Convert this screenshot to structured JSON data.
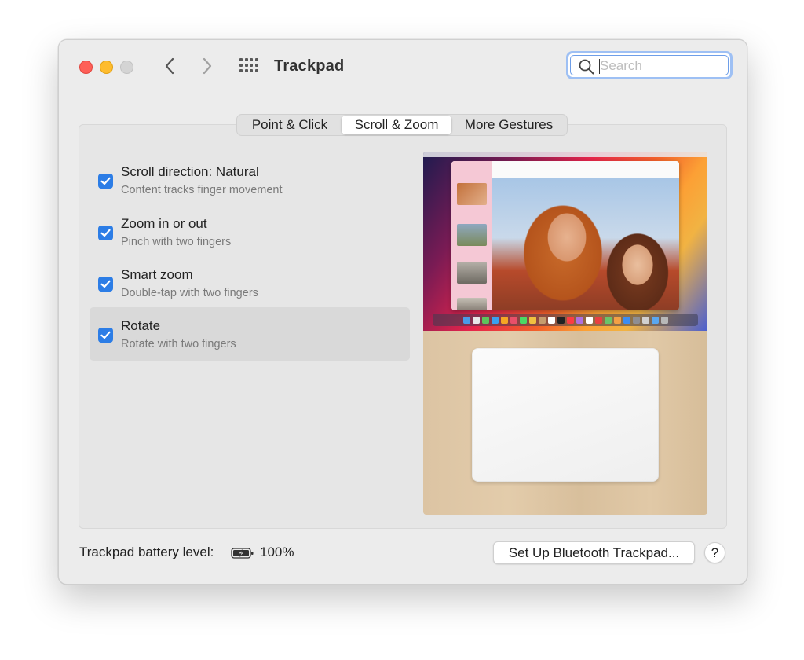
{
  "window": {
    "title": "Trackpad",
    "search_placeholder": "Search"
  },
  "tabs": [
    {
      "label": "Point & Click",
      "selected": false
    },
    {
      "label": "Scroll & Zoom",
      "selected": true
    },
    {
      "label": "More Gestures",
      "selected": false
    }
  ],
  "options": [
    {
      "title": "Scroll direction: Natural",
      "subtitle": "Content tracks finger movement",
      "checked": true,
      "selected": false
    },
    {
      "title": "Zoom in or out",
      "subtitle": "Pinch with two fingers",
      "checked": true,
      "selected": false
    },
    {
      "title": "Smart zoom",
      "subtitle": "Double-tap with two fingers",
      "checked": true,
      "selected": false
    },
    {
      "title": "Rotate",
      "subtitle": "Rotate with two fingers",
      "checked": true,
      "selected": true
    }
  ],
  "footer": {
    "battery_label": "Trackpad battery level:",
    "battery_value": "100%",
    "setup_button": "Set Up Bluetooth Trackpad...",
    "help_button": "?"
  },
  "icons": {
    "back": "chevron-left-icon",
    "forward": "chevron-right-icon",
    "show_all": "grid-icon",
    "search": "search-icon",
    "battery": "battery-charging-icon",
    "checkbox": "checkmark-icon"
  },
  "colors": {
    "accent": "#2c7de6",
    "close": "#fe5f57",
    "minimize": "#febc2e",
    "zoom_disabled": "#d4d4d4",
    "search_focus_ring": "#9ec0f4"
  }
}
